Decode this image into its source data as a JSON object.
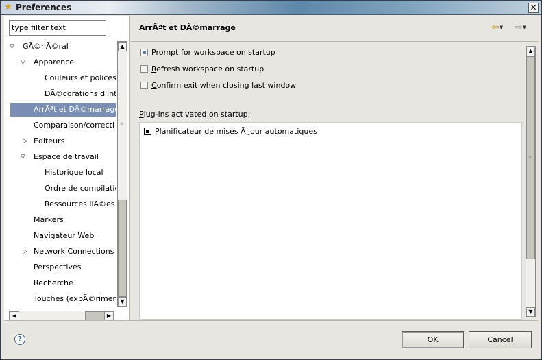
{
  "window": {
    "title": "Preferences",
    "close_glyph": "✕"
  },
  "filter": {
    "value": "type filter text"
  },
  "tree": {
    "items": [
      {
        "label": "GÃ©nÃ©ral",
        "expanded": true
      },
      {
        "label": "Apparence",
        "expanded": true
      },
      {
        "label": "Couleurs et polices"
      },
      {
        "label": "DÃ©corations d'inti"
      },
      {
        "label": "ArrÃªt et DÃ©marrage",
        "selected": true
      },
      {
        "label": "Comparaison/correcti"
      },
      {
        "label": "Editeurs",
        "expanded": false
      },
      {
        "label": "Espace de travail",
        "expanded": true
      },
      {
        "label": "Historique local"
      },
      {
        "label": "Ordre de compilatio"
      },
      {
        "label": "Ressources liÃ©es"
      },
      {
        "label": "Markers"
      },
      {
        "label": "Navigateur Web"
      },
      {
        "label": "Network Connections",
        "expanded": false
      },
      {
        "label": "Perspectives"
      },
      {
        "label": "Recherche"
      },
      {
        "label": "Touches (expÃ©rimer"
      }
    ]
  },
  "page": {
    "title": "ArrÃªt et DÃ©marrage",
    "options": [
      {
        "pre": "Prompt for ",
        "mnemonic": "w",
        "post": "orkspace on startup",
        "checked": true
      },
      {
        "pre": "",
        "mnemonic": "R",
        "post": "efresh workspace on startup",
        "checked": false
      },
      {
        "pre": "",
        "mnemonic": "C",
        "post": "onfirm exit when closing last window",
        "checked": false
      }
    ],
    "plugins_label_mnemonic": "P",
    "plugins_label_rest": "lug-ins activated on startup:",
    "plugins": [
      {
        "label": "Planificateur de mises Ã  jour automatiques",
        "checked": true
      }
    ]
  },
  "buttons": {
    "ok": "OK",
    "cancel": "Cancel",
    "help": "?"
  },
  "icons": {
    "title": "star-icon",
    "back": "back-arrow-icon",
    "forward": "forward-arrow-icon",
    "help": "help-icon"
  }
}
